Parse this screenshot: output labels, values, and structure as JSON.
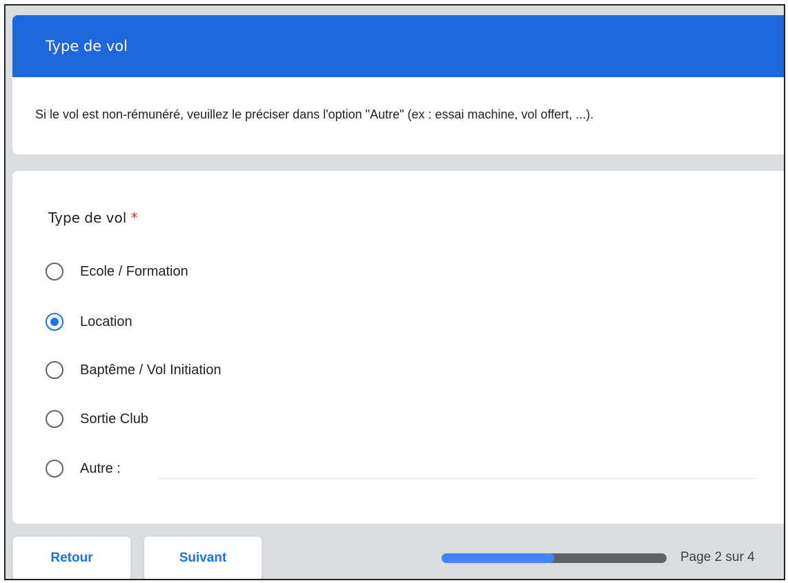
{
  "section": {
    "title": "Type de vol",
    "description": "Si le vol est non-rémunéré, veuillez le préciser dans l'option \"Autre\" (ex : essai machine, vol offert, ...)."
  },
  "question": {
    "title": "Type de vol",
    "required_marker": "*",
    "options": [
      {
        "label": "Ecole / Formation",
        "selected": false
      },
      {
        "label": "Location",
        "selected": true
      },
      {
        "label": "Baptême / Vol Initiation",
        "selected": false
      },
      {
        "label": "Sortie Club",
        "selected": false
      },
      {
        "label": "Autre :",
        "selected": false
      }
    ],
    "other_value": ""
  },
  "navigation": {
    "back_label": "Retour",
    "next_label": "Suivant",
    "progress_fraction": 0.5,
    "page_text": "Page 2 sur 4"
  },
  "colors": {
    "header": "#1f67dd",
    "accent": "#1a73e8",
    "required": "#d93025",
    "progress_fill": "#4285f4",
    "progress_track": "#5f6368"
  }
}
